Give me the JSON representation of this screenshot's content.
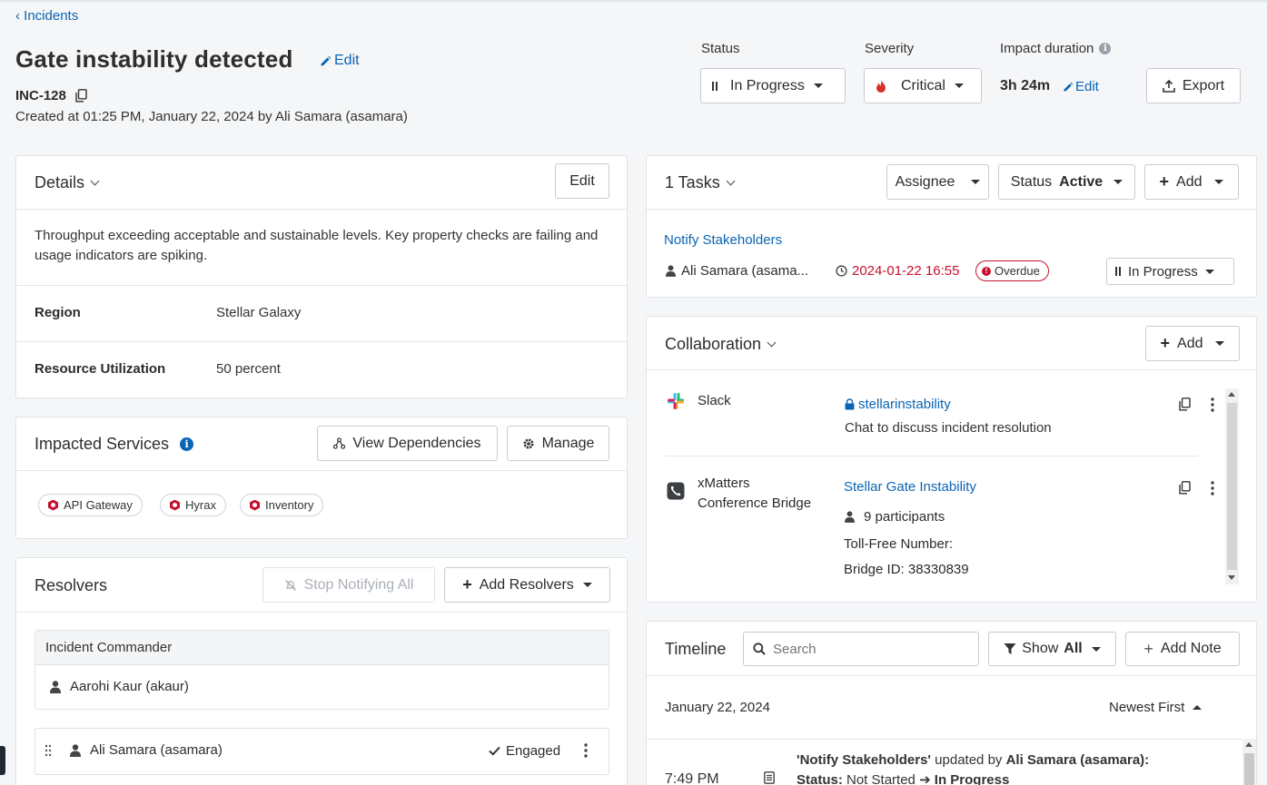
{
  "header": {
    "back_label": "Incidents",
    "title": "Gate instability detected",
    "edit_label": "Edit",
    "incident_id": "INC-128",
    "created": "Created at 01:25 PM, January 22, 2024 by Ali Samara (asamara)",
    "status_label": "Status",
    "status_value": "In Progress",
    "severity_label": "Severity",
    "severity_value": "Critical",
    "impact_label": "Impact duration",
    "impact_value": "3h 24m",
    "impact_edit": "Edit",
    "export_label": "Export"
  },
  "details": {
    "title": "Details",
    "edit_label": "Edit",
    "description": "Throughput exceeding acceptable and sustainable levels. Key property checks are failing and usage indicators are spiking.",
    "fields": [
      {
        "label": "Region",
        "value": "Stellar Galaxy"
      },
      {
        "label": "Resource Utilization",
        "value": "50 percent"
      }
    ]
  },
  "impacted": {
    "title": "Impacted Services",
    "view_deps": "View Dependencies",
    "manage": "Manage",
    "services": [
      "API Gateway",
      "Hyrax",
      "Inventory"
    ]
  },
  "resolvers": {
    "title": "Resolvers",
    "stop_notifying": "Stop Notifying All",
    "add_resolvers": "Add Resolvers",
    "commander_header": "Incident Commander",
    "commander": "Aarohi Kaur (akaur)",
    "resolver": "Ali Samara (asamara)",
    "resolver_status": "Engaged"
  },
  "tasks": {
    "title": "1 Tasks",
    "assignee": "Assignee",
    "status_label": "Status",
    "status_value": "Active",
    "add": "Add",
    "items": [
      {
        "name": "Notify Stakeholders",
        "owner": "Ali Samara (asama...",
        "due": "2024-01-22 16:55",
        "badge": "Overdue",
        "status": "In Progress"
      }
    ]
  },
  "collaboration": {
    "title": "Collaboration",
    "add": "Add",
    "items": [
      {
        "tool": "Slack",
        "link": "stellarinstability",
        "desc": "Chat to discuss incident resolution"
      },
      {
        "tool_line1": "xMatters",
        "tool_line2": "Conference Bridge",
        "link": "Stellar Gate Instability",
        "participants": "9 participants",
        "tollfree": "Toll-Free Number:",
        "bridge": "Bridge ID: 38330839"
      }
    ]
  },
  "timeline": {
    "title": "Timeline",
    "search_placeholder": "Search",
    "show_label": "Show",
    "show_value": "All",
    "add_note": "Add Note",
    "date": "January 22, 2024",
    "sort": "Newest First",
    "entry": {
      "time": "7:49 PM",
      "task": "'Notify Stakeholders'",
      "updated_by": " updated by ",
      "user": "Ali Samara (asamara):",
      "status_key": "Status:",
      "from": " Not Started ",
      "arrow": "➔",
      "to": " In Progress"
    }
  },
  "colors": {
    "link": "#0a64b4",
    "overdue": "#c8102e",
    "critical": "#d93025"
  }
}
